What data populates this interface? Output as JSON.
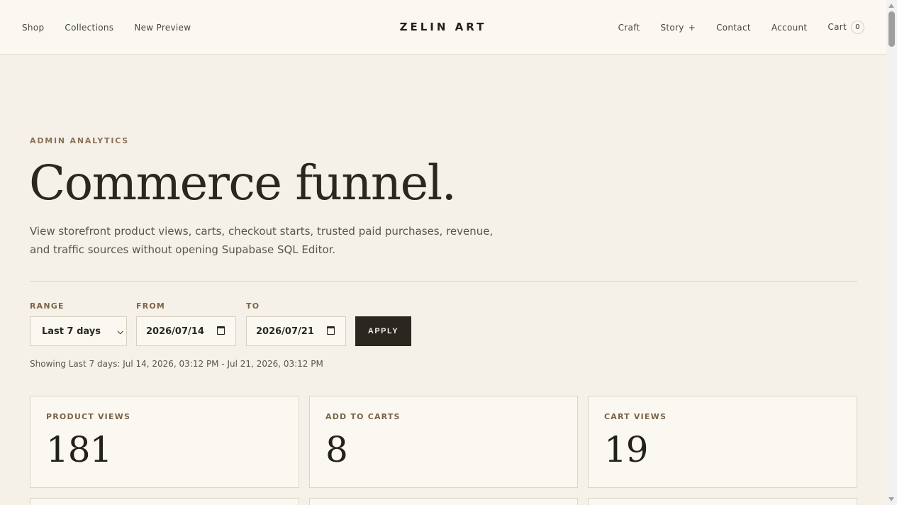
{
  "header": {
    "brand": "ZELIN ART",
    "nav_left": [
      "Shop",
      "Collections",
      "New Preview"
    ],
    "nav_right": {
      "craft": "Craft",
      "story": "Story",
      "story_expand": "+",
      "contact": "Contact",
      "account": "Account",
      "cart": "Cart",
      "cart_count": "0"
    }
  },
  "main": {
    "eyebrow": "ADMIN ANALYTICS",
    "title": "Commerce funnel.",
    "subtitle": "View storefront product views, carts, checkout starts, trusted paid purchases, revenue, and traffic sources without opening Supabase SQL Editor."
  },
  "filters": {
    "range_label": "RANGE",
    "range_value": "Last 7 days",
    "from_label": "FROM",
    "from_value": "2026/07/14",
    "to_label": "TO",
    "to_value": "2026/07/21",
    "apply_label": "APPLY",
    "note": "Showing Last 7 days: Jul 14, 2026, 03:12 PM - Jul 21, 2026, 03:12 PM"
  },
  "metrics": [
    {
      "label": "PRODUCT VIEWS",
      "value": "181"
    },
    {
      "label": "ADD TO CARTS",
      "value": "8"
    },
    {
      "label": "CART VIEWS",
      "value": "19"
    }
  ],
  "icons": {
    "select_arrow": "chevron-down-icon",
    "date_picker": "calendar-icon"
  }
}
